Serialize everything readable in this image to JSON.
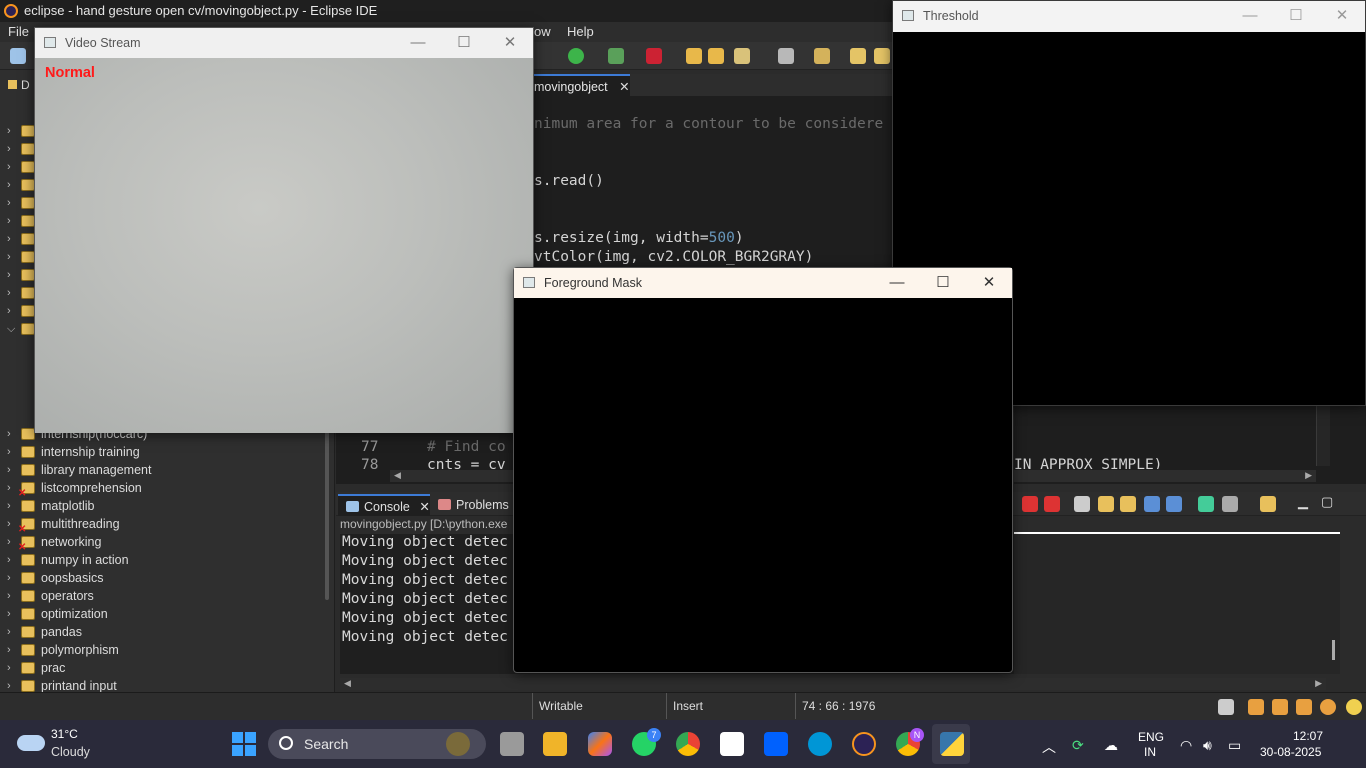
{
  "eclipse": {
    "title": "eclipse - hand gesture open cv/movingobject.py - Eclipse IDE",
    "menu": [
      "File",
      "ow",
      "Help"
    ],
    "explorer_tab": "D",
    "explorer_items": [
      {
        "label": "internship(hoccarc)",
        "error": false
      },
      {
        "label": "internship training",
        "error": false
      },
      {
        "label": "library  management",
        "error": false
      },
      {
        "label": "listcomprehension",
        "error": true
      },
      {
        "label": "matplotlib",
        "error": false
      },
      {
        "label": "multithreading",
        "error": true
      },
      {
        "label": "networking",
        "error": true
      },
      {
        "label": "numpy in action",
        "error": false
      },
      {
        "label": "oopsbasics",
        "error": false
      },
      {
        "label": "operators",
        "error": false
      },
      {
        "label": "optimization",
        "error": false
      },
      {
        "label": "pandas",
        "error": false
      },
      {
        "label": "polymorphism",
        "error": false
      },
      {
        "label": "prac",
        "error": false
      },
      {
        "label": "printand input",
        "error": false
      }
    ],
    "editor_tab": "movingobject",
    "code": {
      "line1": "nimum area for a contour to be considere",
      "line2": "s.read()",
      "line3a": "s.resize(img, width=",
      "line3num": "500",
      "line3b": ")",
      "line4": "vtColor(img, cv2.COLOR_BGR2GRAY)",
      "ln77": "77",
      "ln77code": "# Find co",
      "ln78": "78",
      "ln78code": "cnts = cv",
      "ln78tail": "IN APPROX SIMPLE)"
    },
    "console_tab": "Console",
    "problems_tab": "Problems",
    "console_path": "movingobject.py [D:\\python.exe",
    "console_lines": [
      "Moving object detec",
      "Moving object detec",
      "Moving object detec",
      "Moving object detec",
      "Moving object detec",
      "Moving object detec"
    ],
    "status": {
      "writable": "Writable",
      "insert": "Insert",
      "position": "74 : 66 : 1976"
    }
  },
  "windows": {
    "video": {
      "title": "Video Stream",
      "overlay_text": "Normal"
    },
    "threshold": {
      "title": "Threshold"
    },
    "foreground": {
      "title": "Foreground Mask"
    }
  },
  "taskbar": {
    "weather_temp": "31°C",
    "weather_desc": "Cloudy",
    "search_label": "Search",
    "lang1": "ENG",
    "lang2": "IN",
    "time": "12:07",
    "date": "30-08-2025",
    "whatsapp_badge": "7",
    "chrome_badge": "N"
  },
  "colors": {
    "overlay_red": "#ff1a1a",
    "accent_blue": "#3d7bd6"
  }
}
